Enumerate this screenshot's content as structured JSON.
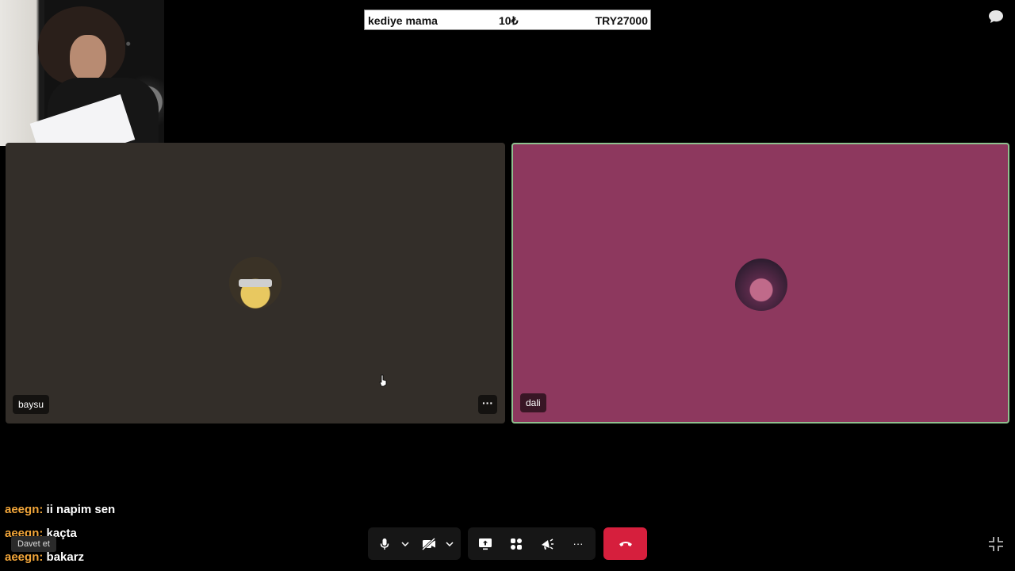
{
  "banner": {
    "item_name": "kediye mama",
    "price": "10₺",
    "total": "TRY27000"
  },
  "participants": [
    {
      "name": "baysu"
    },
    {
      "name": "dali"
    }
  ],
  "tile_menu_label": "···",
  "chat": {
    "messages": [
      {
        "user": "aeegn:",
        "text": "ii napim sen"
      },
      {
        "user": "aeegn:",
        "text": "kaçta"
      },
      {
        "user": "aeegn:",
        "text": "bakarz"
      }
    ],
    "tooltip": "Davet et"
  },
  "controls": {
    "more_label": "···"
  },
  "colors": {
    "tile_baysu": "#332e29",
    "tile_dali": "#8d385e",
    "active_speaker_border": "#8fc08f",
    "hangup": "#d61f3d",
    "chat_user": "#f2a63a"
  }
}
